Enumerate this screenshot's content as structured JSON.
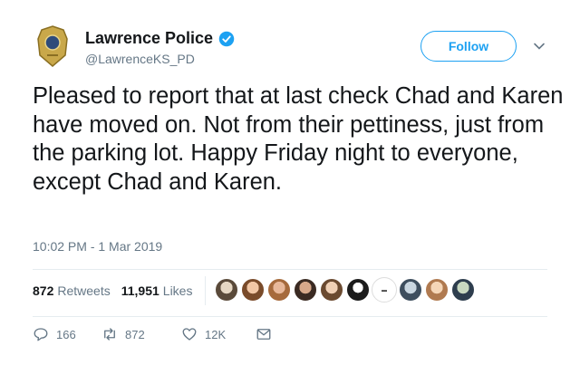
{
  "tweet": {
    "author": {
      "display_name": "Lawrence Police",
      "handle": "@LawrenceKS_PD",
      "avatar_icon": "police-badge-icon",
      "verified_icon": "verified-badge-icon"
    },
    "follow_label": "Follow",
    "menu_icon": "chevron-down-icon",
    "text": "Pleased to report that at last check Chad and Karen have moved on. Not from their pettiness, just from the parking lot. Happy Friday night to everyone, except Chad and Karen.",
    "timestamp": "10:02 PM - 1 Mar 2019",
    "stats": {
      "retweets_count": "872",
      "retweets_label": "Retweets",
      "likes_count": "11,951",
      "likes_label": "Likes"
    },
    "likers_count": 10,
    "actions": {
      "reply_count": "166",
      "retweet_count": "872",
      "like_count": "12K"
    }
  },
  "colors": {
    "accent": "#1da1f2",
    "text": "#14171a",
    "muted": "#657786",
    "divider": "#e6ecf0"
  }
}
